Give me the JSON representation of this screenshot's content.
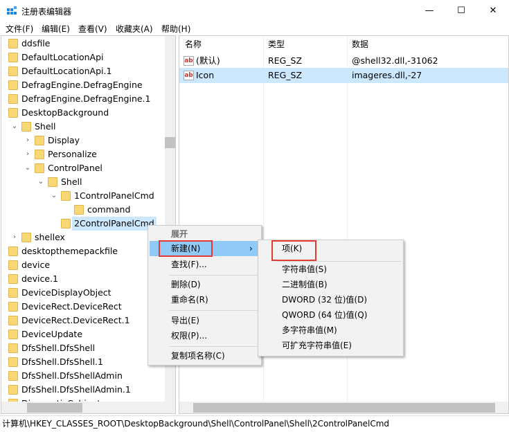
{
  "window": {
    "title": "注册表编辑器",
    "minimize": "—",
    "maximize": "☐",
    "close": "✕"
  },
  "menubar": [
    "文件(F)",
    "编辑(E)",
    "查看(V)",
    "收藏夹(A)",
    "帮助(H)"
  ],
  "tree": [
    {
      "label": "ddsfile",
      "level": 0
    },
    {
      "label": "DefaultLocationApi",
      "level": 0
    },
    {
      "label": "DefaultLocationApi.1",
      "level": 0
    },
    {
      "label": "DefragEngine.DefragEngine",
      "level": 0
    },
    {
      "label": "DefragEngine.DefragEngine.1",
      "level": 0
    },
    {
      "label": "DesktopBackground",
      "level": 0
    },
    {
      "label": "Shell",
      "level": 1,
      "state": "expanded"
    },
    {
      "label": "Display",
      "level": 2,
      "state": "collapsed"
    },
    {
      "label": "Personalize",
      "level": 2,
      "state": "collapsed"
    },
    {
      "label": "ControlPanel",
      "level": 2,
      "state": "expanded"
    },
    {
      "label": "Shell",
      "level": 3,
      "state": "expanded"
    },
    {
      "label": "1ControlPanelCmd",
      "level": 4,
      "state": "expanded"
    },
    {
      "label": "command",
      "level": 5
    },
    {
      "label": "2ControlPanelCmd",
      "level": 4,
      "selected": true
    },
    {
      "label": "shellex",
      "level": 1,
      "state": "collapsed"
    },
    {
      "label": "desktopthemepackfile",
      "level": 0
    },
    {
      "label": "device",
      "level": 0
    },
    {
      "label": "device.1",
      "level": 0
    },
    {
      "label": "DeviceDisplayObject",
      "level": 0
    },
    {
      "label": "DeviceRect.DeviceRect",
      "level": 0
    },
    {
      "label": "DeviceRect.DeviceRect.1",
      "level": 0
    },
    {
      "label": "DeviceUpdate",
      "level": 0
    },
    {
      "label": "DfsShell.DfsShell",
      "level": 0
    },
    {
      "label": "DfsShell.DfsShell.1",
      "level": 0
    },
    {
      "label": "DfsShell.DfsShellAdmin",
      "level": 0
    },
    {
      "label": "DfsShell.DfsShellAdmin.1",
      "level": 0
    },
    {
      "label": "DiagnosticCabinet",
      "level": 0
    }
  ],
  "values": {
    "headers": [
      "名称",
      "类型",
      "数据"
    ],
    "rows": [
      {
        "name": "(默认)",
        "type": "REG_SZ",
        "data": "@shell32.dll,-31062"
      },
      {
        "name": "Icon",
        "type": "REG_SZ",
        "data": "imageres.dll,-27",
        "selected": true
      }
    ]
  },
  "context_menu": {
    "items": [
      "展开",
      "新建(N)",
      "查找(F)...",
      "删除(D)",
      "重命名(R)",
      "导出(E)",
      "权限(P)...",
      "复制项名称(C)"
    ],
    "submenu_arrow": "›"
  },
  "submenu": {
    "items": [
      "项(K)",
      "字符串值(S)",
      "二进制值(B)",
      "DWORD (32 位)值(D)",
      "QWORD (64 位)值(Q)",
      "多字符串值(M)",
      "可扩充字符串值(E)"
    ]
  },
  "status": "计算机\\HKEY_CLASSES_ROOT\\DesktopBackground\\Shell\\ControlPanel\\Shell\\2ControlPanelCmd",
  "colors": {
    "highlight": "#91c9f7",
    "selected_row": "#cce8ff",
    "annotation": "#e53935"
  }
}
